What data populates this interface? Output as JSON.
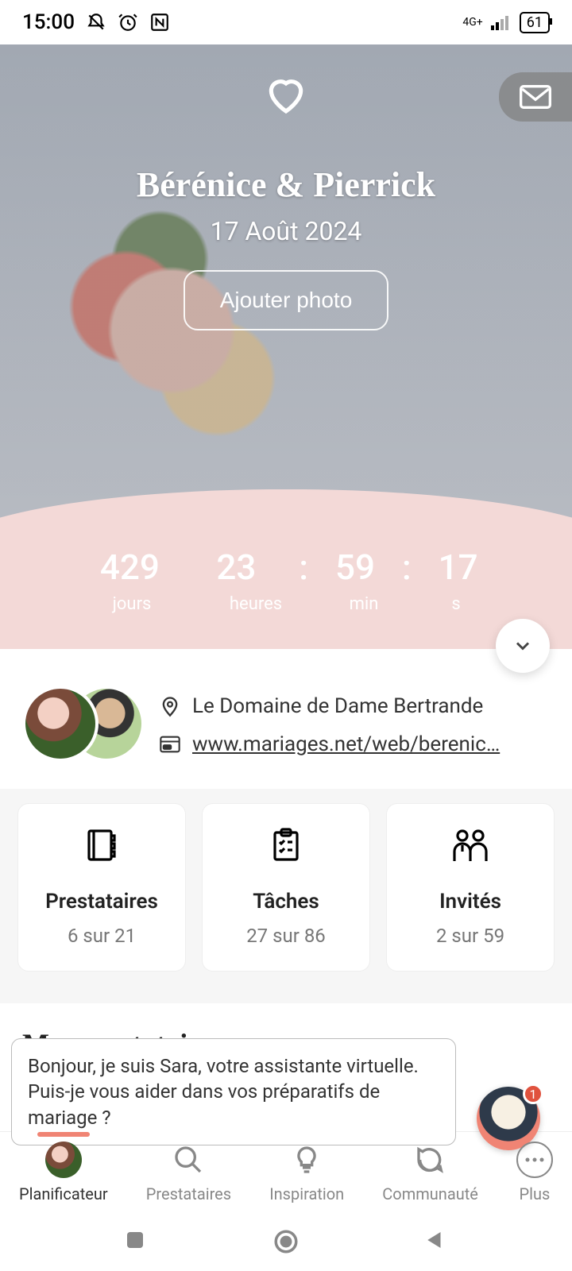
{
  "status_bar": {
    "time": "15:00",
    "network": "4G+",
    "battery": "61"
  },
  "hero": {
    "couple_title": "Bérénice & Pierrick",
    "date": "17 Août 2024",
    "add_photo_label": "Ajouter photo"
  },
  "countdown": {
    "days": "429",
    "hours": "23",
    "mins": "59",
    "secs": "17",
    "label_days": "jours",
    "label_hours": "heures",
    "label_mins": "min",
    "label_secs": "s"
  },
  "info": {
    "venue": "Le Domaine de Dame Bertrande",
    "website": "www.mariages.net/web/berenic…"
  },
  "cards": {
    "vendors": {
      "title": "Prestataires",
      "sub": "6 sur 21"
    },
    "tasks": {
      "title": "Tâches",
      "sub": "27 sur 86"
    },
    "guests": {
      "title": "Invités",
      "sub": "2 sur 59"
    }
  },
  "section": {
    "title": "Mes prestataires"
  },
  "chat": {
    "message": "Bonjour, je suis Sara, votre assistante virtuelle. Puis-je vous aider dans vos préparatifs de mariage ?",
    "badge": "1"
  },
  "nav": {
    "planner": "Planificateur",
    "vendors": "Prestataires",
    "inspiration": "Inspiration",
    "community": "Communauté",
    "more": "Plus"
  }
}
